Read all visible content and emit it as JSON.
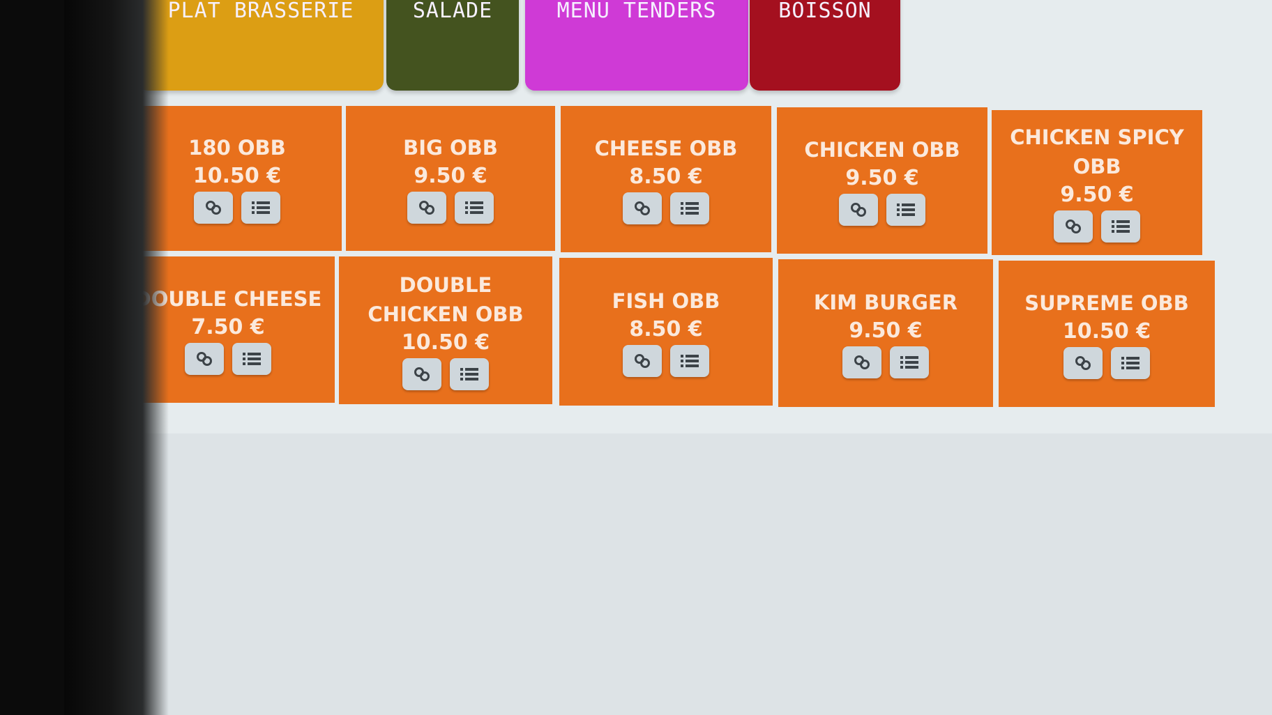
{
  "tabs": [
    {
      "label": "PLAT BRASSERIE",
      "color": "#dc9e14"
    },
    {
      "label": "SALADE",
      "color": "#44531f"
    },
    {
      "label": "MENU TENDERS",
      "color": "#cf3ad6"
    },
    {
      "label": "BOISSON",
      "color": "#a4101f"
    }
  ],
  "accent_color": "#e8701c",
  "button_color": "#cfd7dc",
  "products": [
    {
      "name_lines": [
        "180 OBB"
      ],
      "price": "10.50 €"
    },
    {
      "name_lines": [
        "BIG OBB"
      ],
      "price": "9.50 €"
    },
    {
      "name_lines": [
        "CHEESE OBB"
      ],
      "price": "8.50 €"
    },
    {
      "name_lines": [
        "CHICKEN OBB"
      ],
      "price": "9.50 €"
    },
    {
      "name_lines": [
        "CHICKEN SPICY",
        "OBB"
      ],
      "price": "9.50 €"
    },
    {
      "name_lines": [
        "DOUBLE CHEESE"
      ],
      "price": "7.50 €"
    },
    {
      "name_lines": [
        "DOUBLE",
        "CHICKEN OBB"
      ],
      "price": "10.50 €"
    },
    {
      "name_lines": [
        "FISH OBB"
      ],
      "price": "8.50 €"
    },
    {
      "name_lines": [
        "KIM BURGER"
      ],
      "price": "9.50 €"
    },
    {
      "name_lines": [
        "SUPREME OBB"
      ],
      "price": "10.50 €"
    }
  ],
  "product_buttons": [
    {
      "icon": "link-icon"
    },
    {
      "icon": "list-icon"
    }
  ]
}
